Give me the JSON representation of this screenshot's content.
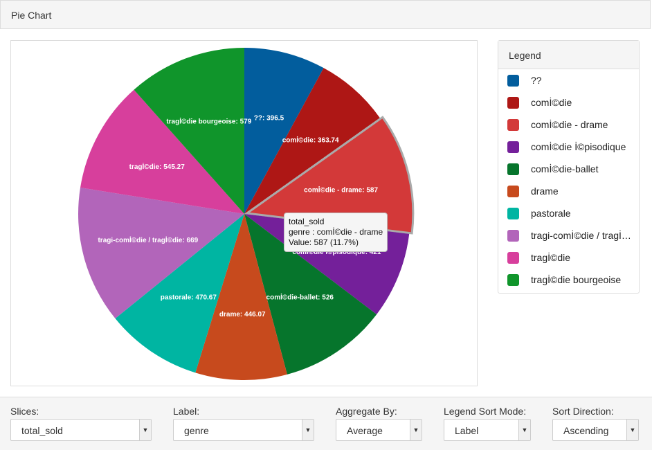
{
  "header": {
    "title": "Pie Chart"
  },
  "legend": {
    "title": "Legend",
    "items": [
      {
        "label": "??",
        "color": "#025d9d"
      },
      {
        "label": "comİ©die",
        "color": "#ae1715"
      },
      {
        "label": "comİ©die - drame",
        "color": "#d33939"
      },
      {
        "label": "comİ©die İ©pisodique",
        "color": "#74209a"
      },
      {
        "label": "comİ©die-ballet",
        "color": "#06752c"
      },
      {
        "label": "drame",
        "color": "#c74a1d"
      },
      {
        "label": "pastorale",
        "color": "#00b5a2"
      },
      {
        "label": "tragi-comİ©die / tragİ©die",
        "color": "#b265ba"
      },
      {
        "label": "tragİ©die",
        "color": "#d73f9c"
      },
      {
        "label": "tragİ©die bourgeoise",
        "color": "#10952b"
      }
    ]
  },
  "tooltip": {
    "line1": "total_sold",
    "line2": "genre : comİ©die - drame",
    "line3": "Value: 587 (11.7%)"
  },
  "chart_data": {
    "type": "pie",
    "categories": [
      "??",
      "comİ©die",
      "comİ©die - drame",
      "comİ©die İ©pisodique",
      "comİ©die-ballet",
      "drame",
      "pastorale",
      "tragi-comİ©die / tragİ©die",
      "tragİ©die",
      "tragİ©die bourgeoise"
    ],
    "values": [
      396.5,
      363.74,
      587,
      421,
      526,
      446.07,
      470.67,
      669,
      545.27,
      579
    ],
    "highlighted": "comİ©die - drame",
    "legend_placement": "right"
  },
  "controls": [
    {
      "label": "Slices:",
      "value": "total_sold"
    },
    {
      "label": "Label:",
      "value": "genre"
    },
    {
      "label": "Aggregate By:",
      "value": "Average"
    },
    {
      "label": "Legend Sort Mode:",
      "value": "Label"
    },
    {
      "label": "Sort Direction:",
      "value": "Ascending"
    }
  ]
}
